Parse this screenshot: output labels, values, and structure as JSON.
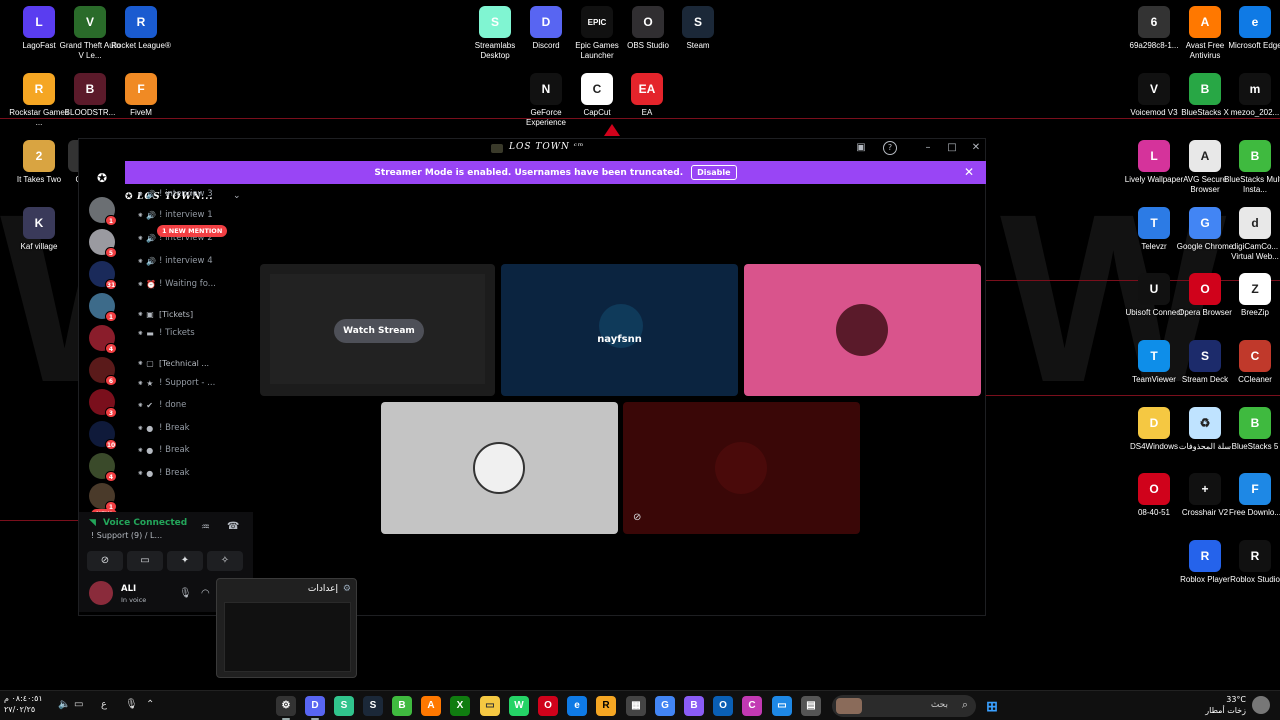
{
  "desktop_icons": [
    {
      "label": "LagoFast",
      "color": "#5a3df0",
      "glyph": "L"
    },
    {
      "label": "Grand Theft Auto V Le...",
      "color": "#2a6b2a",
      "glyph": "V"
    },
    {
      "label": "Rocket League®",
      "color": "#1a5bd0",
      "glyph": "R"
    },
    {
      "label": "Rockstar Games ...",
      "color": "#f5a623",
      "glyph": "R"
    },
    {
      "label": "BLOODSTR...",
      "color": "#5b1a2a",
      "glyph": "B"
    },
    {
      "label": "FiveM",
      "color": "#f08a24",
      "glyph": "F"
    },
    {
      "label": "It Takes Two",
      "color": "#d9a441",
      "glyph": "2"
    },
    {
      "label": "Ca...",
      "color": "#333333",
      "glyph": "C"
    },
    {
      "label": "Kaf village",
      "color": "#3a3a5a",
      "glyph": "K"
    },
    {
      "label": "Streamlabs Desktop",
      "color": "#80f5d2",
      "glyph": "S"
    },
    {
      "label": "Discord",
      "color": "#5865f2",
      "glyph": "D"
    },
    {
      "label": "Epic Games Launcher",
      "color": "#111111",
      "glyph": "EPIC"
    },
    {
      "label": "OBS Studio",
      "color": "#302e31",
      "glyph": "O"
    },
    {
      "label": "Steam",
      "color": "#1b2838",
      "glyph": "S"
    },
    {
      "label": "GeForce Experience",
      "color": "#111111",
      "glyph": "N"
    },
    {
      "label": "CapCut",
      "color": "#ffffff",
      "glyph": "C"
    },
    {
      "label": "EA",
      "color": "#e4242b",
      "glyph": "EA"
    },
    {
      "label": "69a298c8-1...",
      "color": "#333333",
      "glyph": "6"
    },
    {
      "label": "Avast Free Antivirus",
      "color": "#ff7800",
      "glyph": "A"
    },
    {
      "label": "Microsoft Edge",
      "color": "#0f7ae5",
      "glyph": "e"
    },
    {
      "label": "Voicemod V3",
      "color": "#111111",
      "glyph": "V"
    },
    {
      "label": "BlueStacks X",
      "color": "#28a745",
      "glyph": "B"
    },
    {
      "label": "mezoo_202...",
      "color": "#111111",
      "glyph": "m"
    },
    {
      "label": "Lively Wallpaper",
      "color": "#d5339b",
      "glyph": "L"
    },
    {
      "label": "AVG Secure Browser",
      "color": "#e8e8e8",
      "glyph": "A"
    },
    {
      "label": "BlueStacks Multi-Insta...",
      "color": "#3fba3f",
      "glyph": "B"
    },
    {
      "label": "Televzr",
      "color": "#2c7be5",
      "glyph": "T"
    },
    {
      "label": "Google Chrome",
      "color": "#4285f4",
      "glyph": "G"
    },
    {
      "label": "digiCamCo... Virtual Web...",
      "color": "#e8e8e8",
      "glyph": "d"
    },
    {
      "label": "Ubisoft Connect",
      "color": "#111111",
      "glyph": "U"
    },
    {
      "label": "Opera Browser",
      "color": "#d0021b",
      "glyph": "O"
    },
    {
      "label": "BreeZip",
      "color": "#ffffff",
      "glyph": "Z"
    },
    {
      "label": "TeamViewer",
      "color": "#0e8ee9",
      "glyph": "T"
    },
    {
      "label": "Stream Deck",
      "color": "#1c2b6b",
      "glyph": "S"
    },
    {
      "label": "CCleaner",
      "color": "#c0392b",
      "glyph": "C"
    },
    {
      "label": "DS4Windows",
      "color": "#f5c842",
      "glyph": "D"
    },
    {
      "label": "سلة المحذوفات",
      "color": "#bfe3ff",
      "glyph": "♻"
    },
    {
      "label": "BlueStacks 5",
      "color": "#3fba3f",
      "glyph": "B"
    },
    {
      "label": "08-40-51",
      "color": "#d0021b",
      "glyph": "O"
    },
    {
      "label": "Crosshair V2",
      "color": "#111111",
      "glyph": "+"
    },
    {
      "label": "Free Downlo...",
      "color": "#1e88e5",
      "glyph": "F"
    },
    {
      "label": "Roblox Player",
      "color": "#2563eb",
      "glyph": "R"
    },
    {
      "label": "Roblox Studio",
      "color": "#111111",
      "glyph": "R"
    }
  ],
  "discord": {
    "window_title": "LOS TOWN ᶜᵐ",
    "banner_text": "Streamer Mode is enabled. Usernames have been truncated.",
    "banner_button": "Disable",
    "server_name": "LOS TOWN...",
    "mention_badge": "1 NEW MENTION",
    "new_badge": "NEW",
    "guild_badges": [
      "1",
      "5",
      "31",
      "1",
      "4",
      "6",
      "3",
      "10",
      "4",
      "1"
    ],
    "channels": [
      "! interview 3",
      "! interview 1",
      "! interview 2",
      "! interview 4",
      "! Waiting fo...",
      "[Tickets]",
      "! Tickets",
      "[Technical ...",
      "! Support - ...",
      "! done",
      "! Break",
      "! Break",
      "! Break"
    ],
    "voice": {
      "status": "Voice Connected",
      "channel": "! Support (9) / L..."
    },
    "user": {
      "name": "ALI",
      "status": "In voice"
    },
    "stage": {
      "watch_stream": "Watch Stream",
      "tile_name": "nayfsnn"
    }
  },
  "preview": {
    "title": "إعدادات"
  },
  "taskbar": {
    "search_placeholder": "بحث",
    "clock_time": "٠٨:٤٠:٥١ م",
    "clock_date": "٢٧/٠٢/٢٥",
    "weather_temp": "33°C",
    "weather_desc": "زخات أمطار",
    "lang": "ع"
  }
}
